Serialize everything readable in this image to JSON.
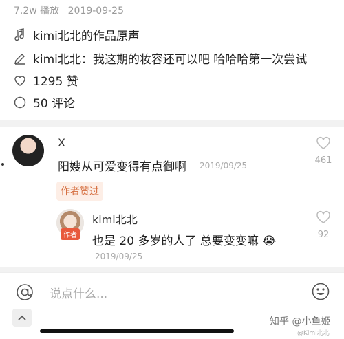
{
  "video": {
    "views": "7.2w 播放",
    "date": "2019-09-25",
    "sound": "kimi北北的作品原声",
    "author_caption_name": "kimi北北",
    "author_caption_sep": "：",
    "author_caption_text": "我这期的妆容还可以吧 哈哈哈第一次尝试",
    "likes": "1295 赞",
    "comments": "50 评论"
  },
  "comment1": {
    "username": "X",
    "text": "阳嫂从可爱变得有点御啊",
    "date": "2019/09/25",
    "likes": "461",
    "badge": "作者赞过"
  },
  "reply1": {
    "username": "kimi北北",
    "author_tag": "作者",
    "text": "也是 20 多岁的人了 总要变变嘛 😭",
    "date": "2019/09/25",
    "likes": "92"
  },
  "bottom": {
    "placeholder": "说点什么...",
    "watermark": "知乎 @小鱼姬",
    "watermark_small": "@Kimi北北"
  },
  "colors": {
    "badge_bg": "#fdeee6",
    "badge_text": "#d46b3b",
    "author_tag": "#e8593c"
  }
}
